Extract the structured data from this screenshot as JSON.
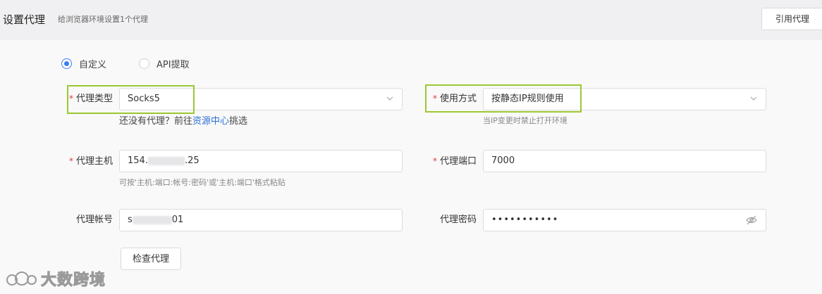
{
  "header": {
    "title": "设置代理",
    "subtitle": "给浏览器环境设置1个代理",
    "ref_button": "引用代理"
  },
  "mode": {
    "options": [
      {
        "label": "自定义",
        "checked": true
      },
      {
        "label": "API提取",
        "checked": false
      }
    ]
  },
  "form": {
    "proxy_type": {
      "label": "代理类型",
      "value": "Socks5"
    },
    "proxy_type_hint": {
      "prefix": "还没有代理？前往",
      "link": "资源中心",
      "suffix": "挑选"
    },
    "usage_mode": {
      "label": "使用方式",
      "value": "按静态IP规则使用"
    },
    "usage_hint": "当IP变更时禁止打开环境",
    "host": {
      "label": "代理主机",
      "value_start": "154.",
      "value_end": ".25"
    },
    "host_hint": "可按'主机:端口:帐号:密码'或'主机:端口'格式粘贴",
    "port": {
      "label": "代理端口",
      "value": "7000"
    },
    "account": {
      "label": "代理帐号",
      "value_start": "s",
      "value_end": "01"
    },
    "password": {
      "label": "代理密码",
      "value": "•••••••••••"
    },
    "required_mark": "*",
    "check_button": "检查代理"
  },
  "watermark": "大数跨境",
  "icons": {
    "chevron": "chevron-down-icon",
    "eye": "eye-off-icon"
  },
  "colors": {
    "accent": "#3d7cf5",
    "required": "#e8373a",
    "highlight": "#9bc832",
    "link": "#2f6fd6"
  }
}
